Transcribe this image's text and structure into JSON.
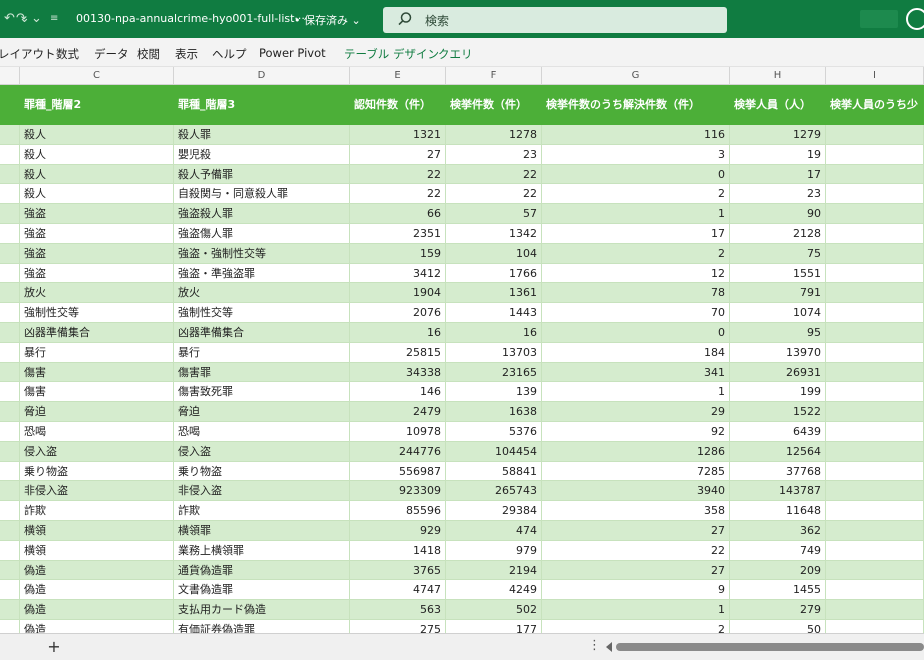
{
  "titlebar": {
    "file_name": "00130-npa-annualcrime-hyo001-full-list···",
    "save_status": "• 保存済み",
    "search_placeholder": "検索"
  },
  "ribbon": {
    "tabs": [
      "レイアウト",
      "数式",
      "データ",
      "校閲",
      "表示",
      "ヘルプ",
      "Power Pivot",
      "テーブル デザイン",
      "クエリ"
    ]
  },
  "columns": [
    "C",
    "D",
    "E",
    "F",
    "G",
    "H",
    "I"
  ],
  "table": {
    "headers": [
      "罪種_階層2",
      "罪種_階層3",
      "認知件数（件）",
      "検挙件数（件）",
      "検挙件数のうち解決件数（件）",
      "検挙人員（人）",
      "検挙人員のうち少"
    ],
    "rows": [
      [
        "殺人",
        "殺人罪",
        "1321",
        "1278",
        "116",
        "1279"
      ],
      [
        "殺人",
        "嬰児殺",
        "27",
        "23",
        "3",
        "19"
      ],
      [
        "殺人",
        "殺人予備罪",
        "22",
        "22",
        "0",
        "17"
      ],
      [
        "殺人",
        "自殺関与・同意殺人罪",
        "22",
        "22",
        "2",
        "23"
      ],
      [
        "強盗",
        "強盗殺人罪",
        "66",
        "57",
        "1",
        "90"
      ],
      [
        "強盗",
        "強盗傷人罪",
        "2351",
        "1342",
        "17",
        "2128"
      ],
      [
        "強盗",
        "強盗・強制性交等",
        "159",
        "104",
        "2",
        "75"
      ],
      [
        "強盗",
        "強盗・準強盗罪",
        "3412",
        "1766",
        "12",
        "1551"
      ],
      [
        "放火",
        "放火",
        "1904",
        "1361",
        "78",
        "791"
      ],
      [
        "強制性交等",
        "強制性交等",
        "2076",
        "1443",
        "70",
        "1074"
      ],
      [
        "凶器準備集合",
        "凶器準備集合",
        "16",
        "16",
        "0",
        "95"
      ],
      [
        "暴行",
        "暴行",
        "25815",
        "13703",
        "184",
        "13970"
      ],
      [
        "傷害",
        "傷害罪",
        "34338",
        "23165",
        "341",
        "26931"
      ],
      [
        "傷害",
        "傷害致死罪",
        "146",
        "139",
        "1",
        "199"
      ],
      [
        "脅迫",
        "脅迫",
        "2479",
        "1638",
        "29",
        "1522"
      ],
      [
        "恐喝",
        "恐喝",
        "10978",
        "5376",
        "92",
        "6439"
      ],
      [
        "侵入盗",
        "侵入盗",
        "244776",
        "104454",
        "1286",
        "12564"
      ],
      [
        "乗り物盗",
        "乗り物盗",
        "556987",
        "58841",
        "7285",
        "37768"
      ],
      [
        "非侵入盗",
        "非侵入盗",
        "923309",
        "265743",
        "3940",
        "143787"
      ],
      [
        "詐欺",
        "詐欺",
        "85596",
        "29384",
        "358",
        "11648"
      ],
      [
        "横領",
        "横領罪",
        "929",
        "474",
        "27",
        "362"
      ],
      [
        "横領",
        "業務上横領罪",
        "1418",
        "979",
        "22",
        "749"
      ],
      [
        "偽造",
        "通貨偽造罪",
        "3765",
        "2194",
        "27",
        "209"
      ],
      [
        "偽造",
        "文書偽造罪",
        "4747",
        "4249",
        "9",
        "1455"
      ],
      [
        "偽造",
        "支払用カード偽造",
        "563",
        "502",
        "1",
        "279"
      ],
      [
        "偽造",
        "有価証券偽造罪",
        "275",
        "177",
        "2",
        "50"
      ]
    ]
  },
  "bottombar": {
    "add_sheet": "+",
    "more": "⋮"
  },
  "colors": {
    "header_green": "#4caf38",
    "row_band": "#d5ecce",
    "titlebar": "#107c41"
  }
}
